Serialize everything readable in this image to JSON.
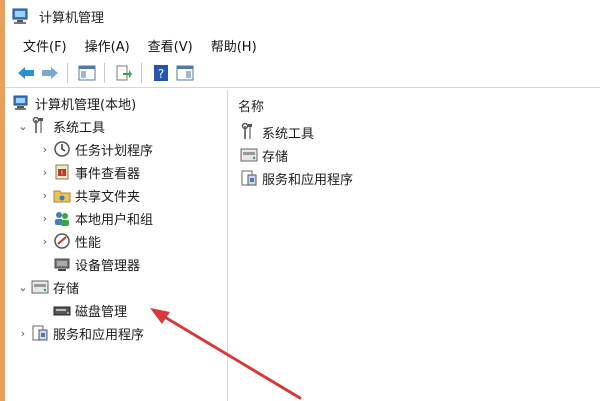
{
  "window": {
    "title": "计算机管理"
  },
  "menu": [
    {
      "label": "文件(F)"
    },
    {
      "label": "操作(A)"
    },
    {
      "label": "查看(V)"
    },
    {
      "label": "帮助(H)"
    }
  ],
  "tree": {
    "root": "计算机管理(本地)",
    "system_tools": "系统工具",
    "task_scheduler": "任务计划程序",
    "event_viewer": "事件查看器",
    "shared_folders": "共享文件夹",
    "local_users": "本地用户和组",
    "performance": "性能",
    "device_manager": "设备管理器",
    "storage": "存储",
    "disk_management": "磁盘管理",
    "services_apps": "服务和应用程序"
  },
  "right_pane": {
    "column_header": "名称",
    "items": [
      {
        "label": "系统工具"
      },
      {
        "label": "存储"
      },
      {
        "label": "服务和应用程序"
      }
    ]
  },
  "colors": {
    "accent_arrow": "#d8383a",
    "window_edge": "#e8a05a"
  }
}
